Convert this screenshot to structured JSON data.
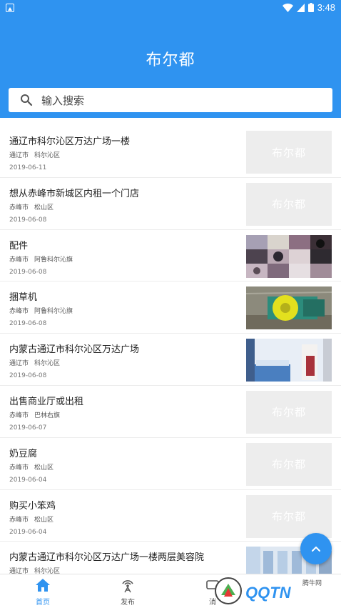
{
  "status_bar": {
    "time": "3:48"
  },
  "header": {
    "title": "布尔都"
  },
  "search": {
    "placeholder": "输入搜索"
  },
  "listings": [
    {
      "title": "通辽市科尔沁区万达广场一楼",
      "city": "通辽市",
      "district": "科尔沁区",
      "date": "2019-06-11",
      "thumb_text": "布尔都"
    },
    {
      "title": "想从赤峰市新城区内租一个门店",
      "city": "赤峰市",
      "district": "松山区",
      "date": "2019-06-08",
      "thumb_text": "布尔都"
    },
    {
      "title": "配件",
      "city": "赤峰市",
      "district": "阿鲁科尔沁旗",
      "date": "2019-06-08",
      "thumb_text": ""
    },
    {
      "title": "捆草机",
      "city": "赤峰市",
      "district": "阿鲁科尔沁旗",
      "date": "2019-06-08",
      "thumb_text": ""
    },
    {
      "title": "内蒙古通辽市科尔沁区万达广场",
      "city": "通辽市",
      "district": "科尔沁区",
      "date": "2019-06-08",
      "thumb_text": ""
    },
    {
      "title": "出售商业厅或出租",
      "city": "赤峰市",
      "district": "巴林右旗",
      "date": "2019-06-07",
      "thumb_text": "布尔都"
    },
    {
      "title": "奶豆腐",
      "city": "赤峰市",
      "district": "松山区",
      "date": "2019-06-04",
      "thumb_text": "布尔都"
    },
    {
      "title": "购买小笨鸡",
      "city": "赤峰市",
      "district": "松山区",
      "date": "2019-06-04",
      "thumb_text": "布尔都"
    },
    {
      "title": "内蒙古通辽市科尔沁区万达广场一楼两层美容院",
      "city": "通辽市",
      "district": "科尔沁区",
      "date": "",
      "thumb_text": ""
    }
  ],
  "bottom_nav": {
    "items": [
      {
        "label": "首页",
        "icon": "home-icon",
        "active": true
      },
      {
        "label": "发布",
        "icon": "broadcast-icon",
        "active": false
      },
      {
        "label": "消",
        "icon": "message-icon",
        "active": false
      }
    ]
  },
  "watermark": {
    "text": "QQTN",
    "sub": "腾牛网"
  },
  "colors": {
    "accent": "#2f93f0",
    "placeholder_thumb": "#ededed"
  }
}
